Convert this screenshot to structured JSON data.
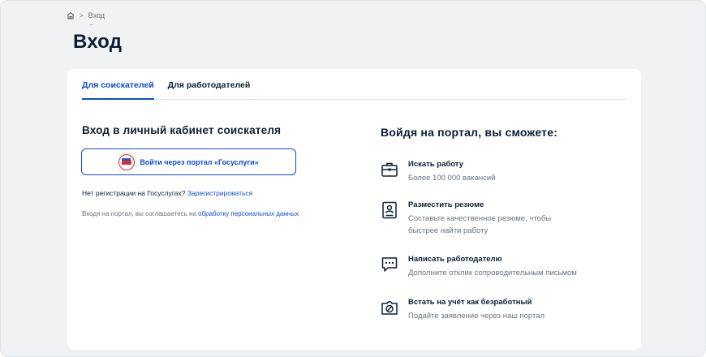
{
  "breadcrumb": {
    "home_icon": "home-icon",
    "separator": ">",
    "current": "Вход"
  },
  "page": {
    "title": "Вход"
  },
  "tabs": [
    {
      "label": "Для соискателей",
      "active": true
    },
    {
      "label": "Для работодателей",
      "active": false
    }
  ],
  "login": {
    "title": "Вход в личный кабинет соискателя",
    "gosuslugi_button": "Войти через портал «Госуслуги»",
    "gosuslugi_logo": "gosuslugi-logo",
    "no_registration": "Нет регистрации на Госуслугах?",
    "register_link": "Зарегистрироваться",
    "consent_text": "Входя на портал, вы соглашаетесь на",
    "consent_link": "обработку персональных данных"
  },
  "benefits": {
    "title": "Войдя на портал, вы сможете:",
    "items": [
      {
        "icon": "briefcase-icon",
        "title": "Искать работу",
        "desc": "Более 100 000 вакансий"
      },
      {
        "icon": "resume-icon",
        "title": "Разместить резюме",
        "desc_line1": "Составьте качественное резюме, чтобы",
        "desc_line2": "быстрее найти работу"
      },
      {
        "icon": "chat-icon",
        "title": "Написать работодателю",
        "desc": "Дополните отклик сопроводительным письмом"
      },
      {
        "icon": "unemployed-icon",
        "title": "Встать на учёт как безработный",
        "desc": "Подайте заявление через наш портал"
      }
    ]
  },
  "colors": {
    "accent": "#0d4cd3",
    "text": "#0b1f33",
    "muted": "#66727f",
    "background": "#f1f2f4"
  }
}
